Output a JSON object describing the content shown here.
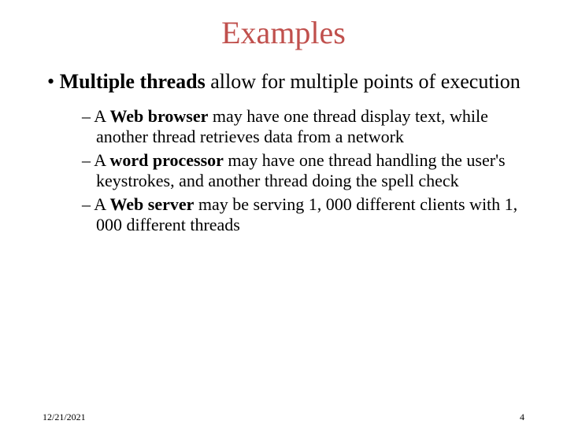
{
  "title": "Examples",
  "bullet_bold": "Multiple threads",
  "bullet_rest": " allow for multiple points of execution",
  "sub1_pre": "A ",
  "sub1_bold": "Web browser",
  "sub1_rest": " may have one thread display text, while another thread retrieves data from a network",
  "sub2_pre": "A ",
  "sub2_bold": "word processor",
  "sub2_rest": " may have one thread handling the user's keystrokes, and another thread doing the spell check",
  "sub3_pre": "A ",
  "sub3_bold": "Web server",
  "sub3_rest": " may be serving 1, 000 different clients with 1, 000 different threads",
  "date": "12/21/2021",
  "page": "4"
}
